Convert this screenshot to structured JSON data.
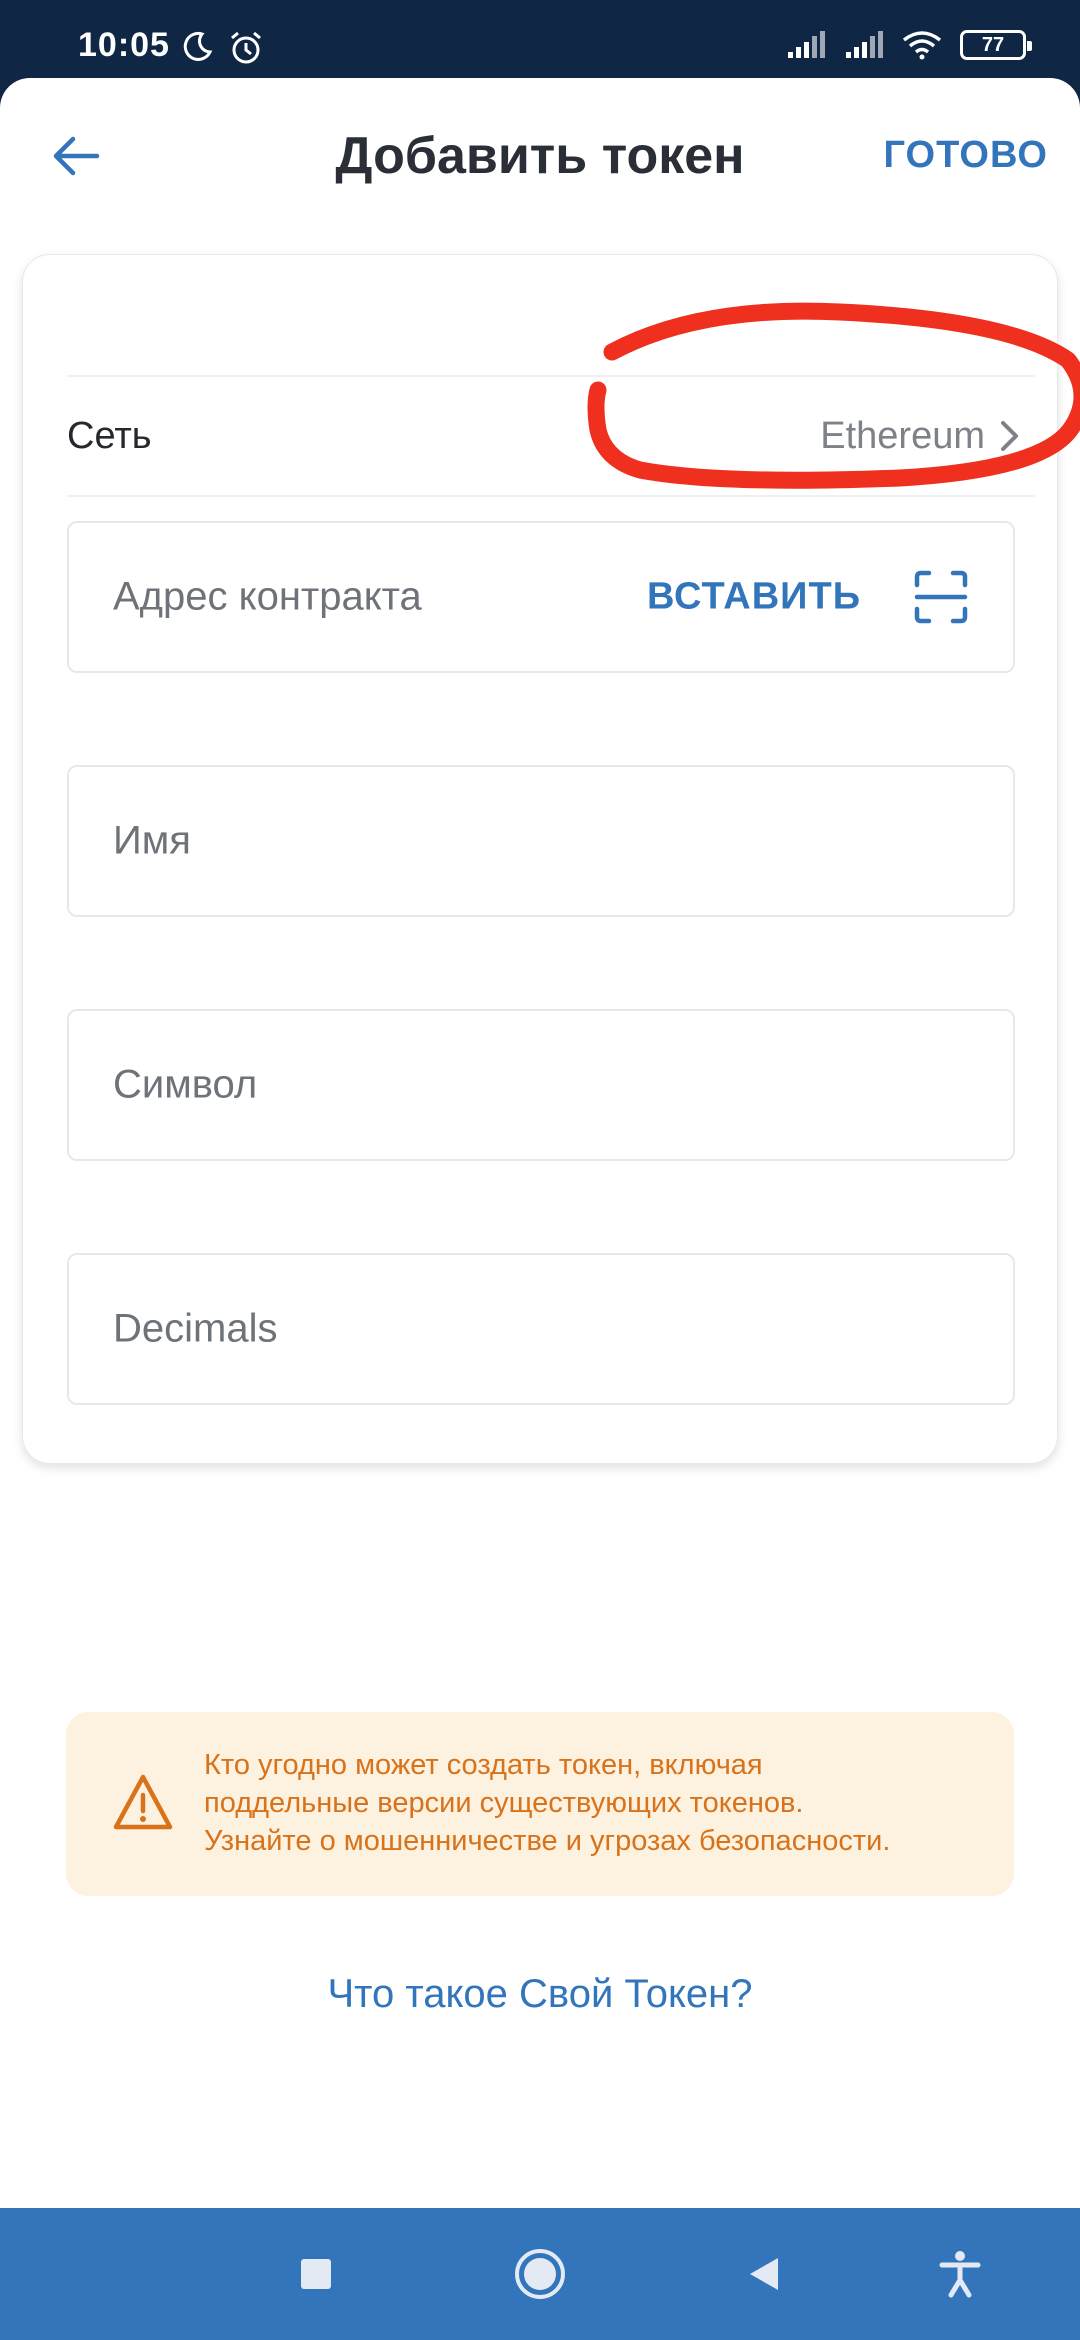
{
  "status_bar": {
    "time": "10:05",
    "battery": "77",
    "icons": [
      "moon-icon",
      "alarm-icon",
      "signal-icon",
      "signal-icon",
      "wifi-icon",
      "battery-icon"
    ]
  },
  "header": {
    "title": "Добавить токен",
    "done_label": "ГОТОВО",
    "back_icon": "arrow-left-icon"
  },
  "form": {
    "network_label": "Сеть",
    "network_value": "Ethereum",
    "contract_placeholder": "Адрес контракта",
    "paste_label": "ВСТАВИТЬ",
    "name_placeholder": "Имя",
    "symbol_placeholder": "Символ",
    "decimals_placeholder": "Decimals"
  },
  "warning": {
    "line1": "Кто угодно может создать токен, включая",
    "line2": "поддельные версии существующих токенов.",
    "line3": "Узнайте о мошенничестве и угрозах безопасности."
  },
  "link": {
    "label": "Что такое Свой Токен?"
  },
  "colors": {
    "accent": "#3375bb",
    "warning_text": "#d8721b",
    "warning_bg": "#fdf1df",
    "annotation": "#f0301e",
    "status_bar": "#0f2745"
  }
}
